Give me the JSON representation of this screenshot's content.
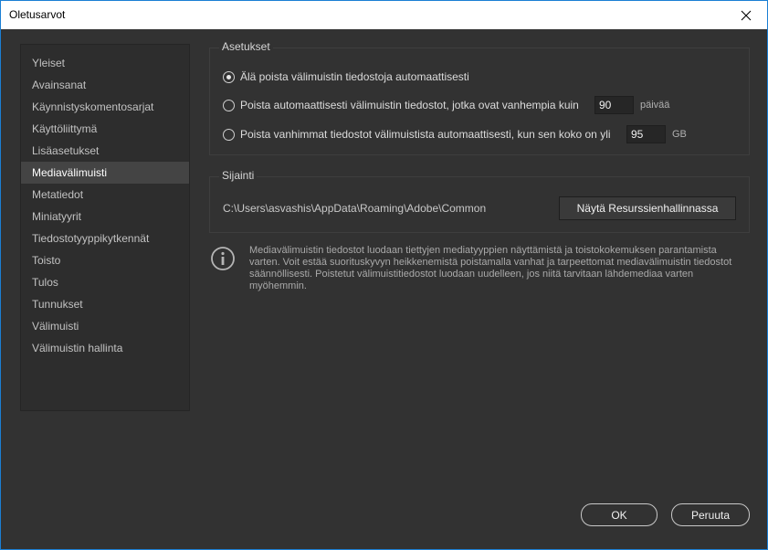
{
  "window": {
    "title": "Oletusarvot"
  },
  "sidebar": {
    "items": [
      {
        "label": "Yleiset"
      },
      {
        "label": "Avainsanat"
      },
      {
        "label": "Käynnistyskomentosarjat"
      },
      {
        "label": "Käyttöliittymä"
      },
      {
        "label": "Lisäasetukset"
      },
      {
        "label": "Mediavälimuisti",
        "selected": true
      },
      {
        "label": "Metatiedot"
      },
      {
        "label": "Miniatyyrit"
      },
      {
        "label": "Tiedostotyyppikytkennät"
      },
      {
        "label": "Toisto"
      },
      {
        "label": "Tulos"
      },
      {
        "label": "Tunnukset"
      },
      {
        "label": "Välimuisti"
      },
      {
        "label": "Välimuistin hallinta"
      }
    ]
  },
  "settings": {
    "group_label": "Asetukset",
    "option1": {
      "label": "Älä poista välimuistin tiedostoja automaattisesti",
      "checked": true
    },
    "option2": {
      "label": "Poista automaattisesti välimuistin tiedostot, jotka ovat vanhempia kuin",
      "value": "90",
      "unit": "päivää",
      "checked": false
    },
    "option3": {
      "label": "Poista vanhimmat tiedostot välimuistista automaattisesti, kun sen koko on yli",
      "value": "95",
      "unit": "GB",
      "checked": false
    }
  },
  "location": {
    "group_label": "Sijainti",
    "path": "C:\\Users\\asvashis\\AppData\\Roaming\\Adobe\\Common",
    "show_button": "Näytä Resurssienhallinnassa"
  },
  "info": {
    "text": "Mediavälimuistin tiedostot luodaan tiettyjen mediatyyppien näyttämistä ja toistokokemuksen parantamista varten. Voit estää suorituskyvyn heikkenemistä poistamalla vanhat ja tarpeettomat mediavälimuistin tiedostot säännöllisesti. Poistetut välimuistitiedostot luodaan uudelleen, jos niitä tarvitaan lähdemediaa varten myöhemmin."
  },
  "footer": {
    "ok": "OK",
    "cancel": "Peruuta"
  },
  "colors": {
    "background": "#323232",
    "sidebar_bg": "#2d2d2d",
    "selected_bg": "#444444",
    "title_bar": "#ffffff",
    "window_border": "#1b7fd4"
  }
}
